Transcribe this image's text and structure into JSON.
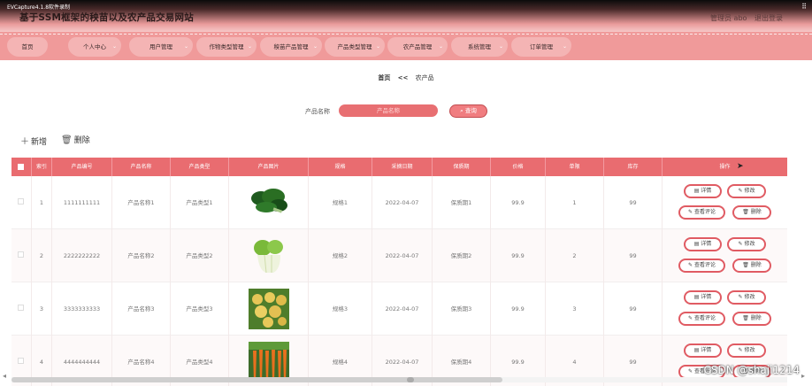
{
  "recorder": {
    "label": "EVCapture4.1.8软件录制",
    "win_icon": "⠿"
  },
  "header": {
    "title": "基于SSM框架的秧苗以及农产品交易网站",
    "admin_label": "管理员 abo",
    "logout_label": "退出登录"
  },
  "nav": {
    "items": [
      {
        "label": "首页"
      },
      {
        "label": "个人中心"
      },
      {
        "label": "用户管理"
      },
      {
        "label": "作物类型管理"
      },
      {
        "label": "秧苗产品管理"
      },
      {
        "label": "产品类型管理"
      },
      {
        "label": "农产品管理"
      },
      {
        "label": "系统管理"
      },
      {
        "label": "订单管理"
      }
    ]
  },
  "breadcrumb": {
    "home": "首页",
    "sep": "<<",
    "current": "农产品"
  },
  "search": {
    "label": "产品名称",
    "placeholder": "产品名称",
    "button": "查询",
    "button_icon": "search-icon"
  },
  "actions": {
    "add": "新增",
    "delete": "删除"
  },
  "table": {
    "headers": [
      "",
      "索引",
      "产品编号",
      "产品名称",
      "产品类型",
      "产品图片",
      "规格",
      "采摘日期",
      "保质期",
      "价格",
      "单限",
      "库存",
      "操作"
    ],
    "rows": [
      {
        "index": "1",
        "code": "1111111111",
        "name": "产品名称1",
        "type": "产品类型1",
        "image": "spinach",
        "spec": "规格1",
        "date": "2022-04-07",
        "shelf": "保质期1",
        "price": "99.9",
        "limit": "1",
        "stock": "99"
      },
      {
        "index": "2",
        "code": "2222222222",
        "name": "产品名称2",
        "type": "产品类型2",
        "image": "bok-choy",
        "spec": "规格2",
        "date": "2022-04-07",
        "shelf": "保质期2",
        "price": "99.9",
        "limit": "2",
        "stock": "99"
      },
      {
        "index": "3",
        "code": "3333333333",
        "name": "产品名称3",
        "type": "产品类型3",
        "image": "potatoes",
        "spec": "规格3",
        "date": "2022-04-07",
        "shelf": "保质期3",
        "price": "99.9",
        "limit": "3",
        "stock": "99"
      },
      {
        "index": "4",
        "code": "4444444444",
        "name": "产品名称4",
        "type": "产品类型4",
        "image": "carrots",
        "spec": "规格4",
        "date": "2022-04-07",
        "shelf": "保质期4",
        "price": "99.9",
        "limit": "4",
        "stock": "99"
      }
    ],
    "row_buttons": {
      "detail": "详情",
      "edit": "修改",
      "comments": "查看评论",
      "delete": "删除"
    }
  },
  "watermark": "CSDN @shaji1214",
  "colors": {
    "accent": "#e96c70",
    "nav": "#f09a9a",
    "button_border": "#e05b63"
  }
}
